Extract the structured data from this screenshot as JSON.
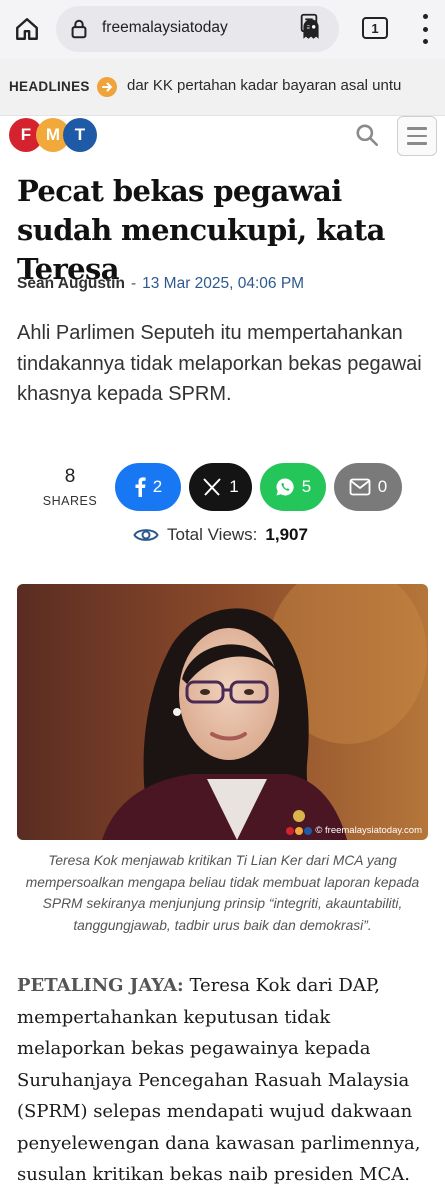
{
  "browser": {
    "url": "freemalaysiatoday",
    "tab_count": "1"
  },
  "ticker": {
    "label": "HEADLINES",
    "text": "dar KK pertahan kadar bayaran asal untu"
  },
  "site": {
    "logo_letters": [
      "F",
      "M",
      "T"
    ],
    "logo_colors": [
      "#d4232e",
      "#f2a93b",
      "#1f5aa6"
    ]
  },
  "article": {
    "title": "Pecat bekas pegawai sudah mencukupi, kata Teresa",
    "author": "Sean Augustin",
    "separator": "-",
    "date": "13 Mar 2025, 04:06 PM",
    "lede": "Ahli Parlimen Seputeh itu mempertahankan tindakannya tidak melaporkan bekas pegawai khasnya kepada SPRM.",
    "shares": {
      "count": "8",
      "label": "SHARES",
      "facebook": "2",
      "x": "1",
      "whatsapp": "5",
      "email": "0"
    },
    "views_label": "Total Views:",
    "views_count": "1,907",
    "image_watermark": "© freemalaysiatoday.com",
    "caption": "Teresa Kok menjawab kritikan Ti Lian Ker dari MCA yang mempersoalkan mengapa beliau tidak membuat laporan kepada SPRM sekiranya menjunjung prinsip “integriti, akauntabiliti, tanggungjawab, tadbir urus baik dan demokrasi”.",
    "dateline": "PETALING JAYA:",
    "body": "Teresa Kok dari DAP, mempertahankan keputusan tidak melaporkan bekas pegawainya kepada Suruhanjaya Pencegahan Rasuah Malaysia (SPRM) selepas mendapati wujud dakwaan penyelewengan dana kawasan parlimennya, susulan kritikan bekas naib presiden MCA."
  },
  "colors": {
    "facebook": "#1877f2",
    "x": "#141414",
    "whatsapp": "#25c659",
    "email": "#7a7a7a",
    "date_link": "#2d5a8c",
    "ticker_accent": "#f0a33a"
  },
  "icons": [
    "home-icon",
    "lock-icon",
    "ghost-icon",
    "reader-mode-icon",
    "tabs-icon",
    "more-vert-icon",
    "arrow-right-icon",
    "search-icon",
    "menu-icon",
    "facebook-icon",
    "x-icon",
    "whatsapp-icon",
    "mail-icon",
    "eye-icon"
  ]
}
